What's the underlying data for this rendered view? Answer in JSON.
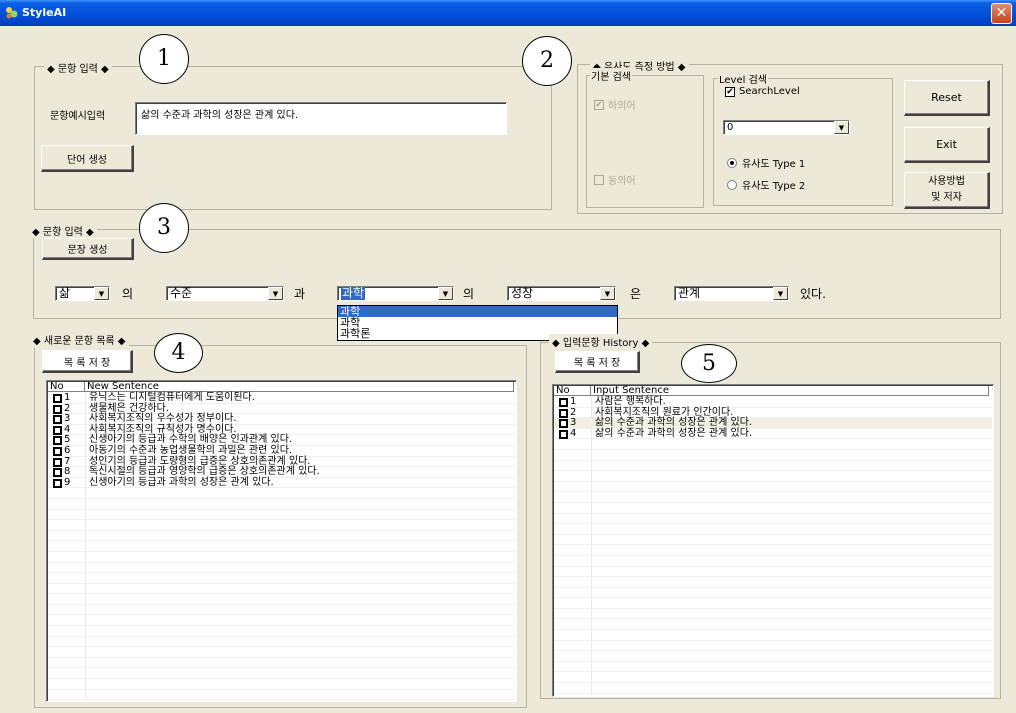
{
  "window": {
    "title": "StyleAI",
    "close_glyph": "✕"
  },
  "markers": [
    "1",
    "2",
    "3",
    "4",
    "5"
  ],
  "group1": {
    "label": "◆ 문항 입력 ◆",
    "example_label": "문항예시입력",
    "example_value": "삶의 수준과 과학의 성장은 관계 있다.",
    "generate_button": "단어 생성"
  },
  "group2": {
    "label": "◆ 유사도 측정 방법 ◆",
    "basic": {
      "label": "기본 검색",
      "hyponym": "하의어",
      "synonym": "동의어"
    },
    "level": {
      "label": "Level 검색",
      "search_level": "SearchLevel",
      "level_value": "0",
      "type1": "유사도 Type 1",
      "type2": "유사도 Type 2"
    },
    "reset_button": "Reset",
    "exit_button": "Exit",
    "usage_button_line1": "사용방법",
    "usage_button_line2": "및 저자"
  },
  "group3": {
    "label": "◆ 문항 입력 ◆",
    "sentence_button": "문장 생성",
    "words": [
      "삶",
      "수준",
      "과학",
      "성장",
      "관계"
    ],
    "joiners": [
      "의",
      "과",
      "의",
      "은",
      "있다."
    ],
    "dropdown_options": [
      "과학",
      "과학",
      "과학론"
    ]
  },
  "group4": {
    "label": "◆ 새로운 문항 목록 ◆",
    "save_button": "목 록 저 장",
    "columns": [
      "No",
      "New Sentence"
    ],
    "rows": [
      {
        "no": "1",
        "text": "유닉스는 디지털컴퓨터에게 도움이된다."
      },
      {
        "no": "2",
        "text": "생물체은 건강하다."
      },
      {
        "no": "3",
        "text": "사회복지조직의 우수성가 정부이다."
      },
      {
        "no": "4",
        "text": "사회복지조직의 규칙성가 명수이다."
      },
      {
        "no": "5",
        "text": "신생아기의 등급과 수학의 배양은 인과관계 있다."
      },
      {
        "no": "6",
        "text": "아동기의 수준과 농업생물학의 과밀은 관련 있다."
      },
      {
        "no": "7",
        "text": "성인기의 등급과 도량형의 급증은 상호의존관계 있다."
      },
      {
        "no": "8",
        "text": "독신시절의 등급과 영양학의 급증은 상호의존관계 있다."
      },
      {
        "no": "9",
        "text": "신생아기의 등급과 과학의 성장은 관계 있다."
      }
    ]
  },
  "group5": {
    "label": "◆ 입력문항 History ◆",
    "save_button": "목 록 저 장",
    "columns": [
      "No",
      "Input Sentence"
    ],
    "rows": [
      {
        "no": "1",
        "text": "사람은 행복하다."
      },
      {
        "no": "2",
        "text": "사회복지조직의 원료가 인간이다."
      },
      {
        "no": "3",
        "text": "삶의 수준과 과학의 성장은 관계 있다."
      },
      {
        "no": "4",
        "text": "삶의 수준과 과학의 성장은 관계 있다."
      }
    ]
  }
}
